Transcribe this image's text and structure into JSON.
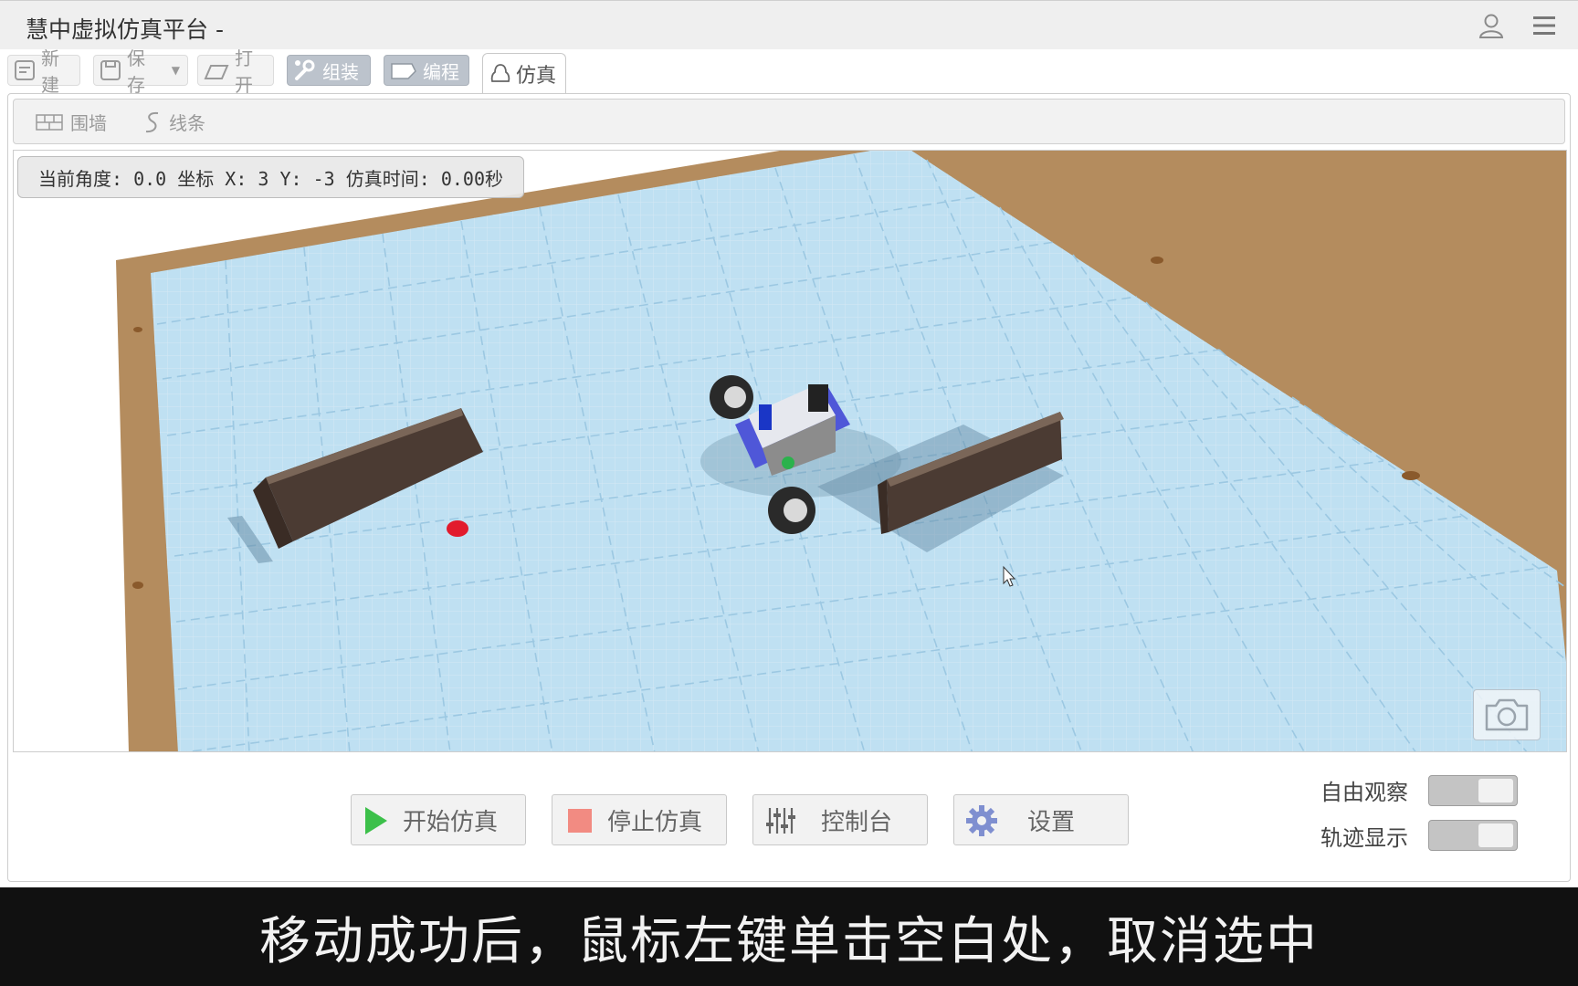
{
  "app": {
    "title": "慧中虚拟仿真平台 -"
  },
  "toolbar": {
    "new_label": "新建",
    "save_label": "保存",
    "open_label": "打开",
    "assemble_label": "组装",
    "program_label": "编程",
    "simulate_label": "仿真"
  },
  "subtoolbar": {
    "wall_label": "围墙",
    "line_label": "线条"
  },
  "status": {
    "readout": "当前角度: 0.0 坐标 X: 3 Y: -3  仿真时间: 0.00秒"
  },
  "controls": {
    "start_label": "开始仿真",
    "stop_label": "停止仿真",
    "console_label": "控制台",
    "settings_label": "设置",
    "free_view_label": "自由观察",
    "free_view_on": false,
    "trace_label": "轨迹显示",
    "trace_on": false
  },
  "subtitle": {
    "text": "移动成功后，鼠标左键单击空白处，取消选中"
  },
  "colors": {
    "accent_start": "#3cc04a",
    "accent_stop": "#f28b82",
    "floor": "#bfe0f2",
    "frame": "#b48c5e"
  }
}
